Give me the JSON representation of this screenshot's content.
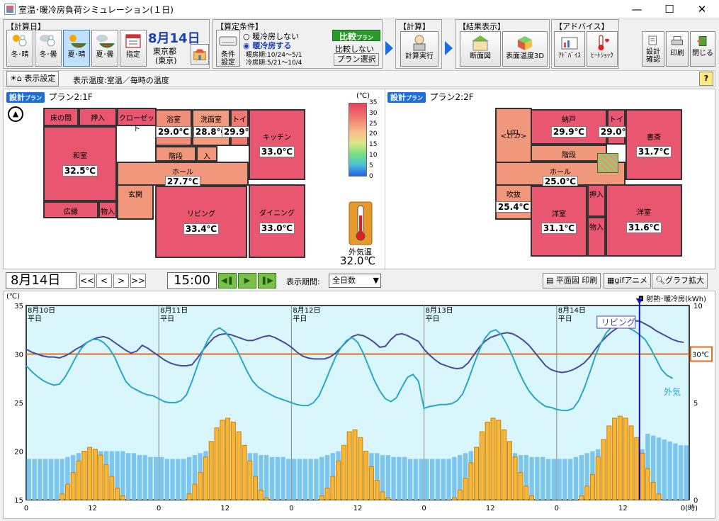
{
  "window": {
    "title": "室温･暖冷房負荷シミュレーション(１日)",
    "minimize": "—",
    "maximize": "☐",
    "close": "✕"
  },
  "calc_day": {
    "label": "【計算日】",
    "buttons": [
      {
        "label": "冬･晴",
        "icon": "sun-snowman-icon"
      },
      {
        "label": "冬･曇",
        "icon": "cloud-snowman-icon"
      },
      {
        "label": "夏･晴",
        "icon": "sun-watermelon-icon",
        "selected": true
      },
      {
        "label": "夏･曇",
        "icon": "cloud-watermelon-icon"
      },
      {
        "label": "指定",
        "icon": "calendar-icon"
      }
    ],
    "date": "8月14日",
    "location1": "東京都",
    "location2": "(東京)"
  },
  "conditions": {
    "label": "【算定条件】",
    "setting_label1": "条件",
    "setting_label2": "設定",
    "radio_off": "暖冷房しない",
    "radio_on": "暖冷房する",
    "heating_period": "暖房期:10/24～5/1",
    "cooling_period": "冷房期:5/21～10/4",
    "compare_label": "比較",
    "compare_sub": "プラン",
    "compare_value": "比較しない",
    "plan_select": "プラン選択"
  },
  "calc": {
    "label": "【計算】",
    "run": "計算実行"
  },
  "result": {
    "label": "【結果表示】",
    "section": "断面図",
    "surface": "表面温度3D"
  },
  "advice": {
    "label": "【アドバイス】",
    "advice": "ｱﾄﾞﾊﾞｲｽ",
    "heatshock": "ﾋｰﾄｼｮｯｸ"
  },
  "right_buttons": {
    "design_check1": "設計",
    "design_check2": "確認",
    "print": "印刷",
    "close": "閉じる"
  },
  "display_bar": {
    "setting": "表示設定",
    "info": "表示温度:室温／毎時の温度",
    "help": "?"
  },
  "floor1": {
    "badge": "設計",
    "badge_sub": "プラン",
    "title": "プラン2:1F",
    "rooms": [
      {
        "name": "床の間",
        "temp": "",
        "color": "#e85670"
      },
      {
        "name": "押入",
        "temp": "",
        "color": "#e85670"
      },
      {
        "name": "クローゼット",
        "temp": "",
        "color": "#e85670"
      },
      {
        "name": "和室",
        "temp": "32.5℃",
        "color": "#e85670"
      },
      {
        "name": "浴室",
        "temp": "29.0℃",
        "color": "#f08e7a"
      },
      {
        "name": "洗面室",
        "temp": "28.8℃",
        "color": "#f09c80"
      },
      {
        "name": "トイレ",
        "temp": "29.9℃",
        "color": "#f07a72"
      },
      {
        "name": "キッチン",
        "temp": "33.0℃",
        "color": "#e85670"
      },
      {
        "name": "階段",
        "temp": "",
        "color": "#f0977c"
      },
      {
        "name": "入",
        "temp": "",
        "color": "#f0977c"
      },
      {
        "name": "ホール",
        "temp": "27.7℃",
        "color": "#f0977c"
      },
      {
        "name": "広縁",
        "temp": "",
        "color": "#e85670"
      },
      {
        "name": "物入",
        "temp": "",
        "color": "#e85670"
      },
      {
        "name": "玄関",
        "temp": "",
        "color": "#f0977c"
      },
      {
        "name": "リビング",
        "temp": "33.4℃",
        "color": "#e85670"
      },
      {
        "name": "ダイニング",
        "temp": "33.0℃",
        "color": "#e85670"
      }
    ]
  },
  "scale": {
    "unit": "(℃)",
    "ticks": [
      "35",
      "30",
      "25",
      "20",
      "15",
      "10",
      "5",
      "0"
    ],
    "outdoor_label": "外気温",
    "outdoor_temp": "32.0℃"
  },
  "floor2": {
    "badge": "設計",
    "badge_sub": "プラン",
    "title": "プラン2:2F",
    "rooms": [
      {
        "name": "<ｴｱｺﾝ>",
        "temp": "",
        "color": "#f0977c"
      },
      {
        "name": "UTL",
        "temp": "",
        "color": "#f0977c"
      },
      {
        "name": "納戸",
        "temp": "29.9℃",
        "color": "#e85670"
      },
      {
        "name": "トイレ",
        "temp": "29.0℃",
        "color": "#e85670"
      },
      {
        "name": "書斎",
        "temp": "31.7℃",
        "color": "#e85670"
      },
      {
        "name": "階段",
        "temp": "",
        "color": "#f0977c"
      },
      {
        "name": "ホール",
        "temp": "25.0℃",
        "color": "#f0977c"
      },
      {
        "name": "吹抜",
        "temp": "25.4℃",
        "color": "#f0977c"
      },
      {
        "name": "押入",
        "temp": "",
        "color": "#e85670"
      },
      {
        "name": "洋室",
        "temp": "31.1℃",
        "color": "#e85670"
      },
      {
        "name": "物入",
        "temp": "",
        "color": "#e85670"
      },
      {
        "name": "洋室",
        "temp": "31.6℃",
        "color": "#e85670"
      }
    ]
  },
  "timebar": {
    "date": "8月14日",
    "nav": [
      "<<",
      "<",
      ">",
      ">>"
    ],
    "time": "15:00",
    "period_label": "表示期間:",
    "period_value": "全日数",
    "print_plan": "平面図 印刷",
    "gif": "gifアニメ",
    "zoom": "グラフ拡大"
  },
  "chart_data": {
    "type": "line",
    "ylabel": "(℃)",
    "y2label": "射熱･暖冷房(kWh)",
    "ylim": [
      15,
      35
    ],
    "y2lim": [
      0,
      10
    ],
    "x_ticks": [
      "0",
      "12",
      "0",
      "12",
      "0",
      "12",
      "0",
      "12",
      "0",
      "12",
      "0(時)"
    ],
    "days": [
      {
        "date": "8月10日",
        "type": "平日"
      },
      {
        "date": "8月11日",
        "type": "平日"
      },
      {
        "date": "8月12日",
        "type": "平日"
      },
      {
        "date": "8月13日",
        "type": "平日"
      },
      {
        "date": "8月14日",
        "type": "平日"
      }
    ],
    "y_ticks": [
      "35",
      "30",
      "25",
      "20",
      "15"
    ],
    "y2_ticks": [
      "10",
      "5",
      "0"
    ],
    "threshold": {
      "value": 30,
      "label": "30℃",
      "color": "#e07020"
    },
    "current_hour": 111,
    "series": [
      {
        "name": "リビング",
        "color": "#4a4a9a",
        "values": [
          30.5,
          30.2,
          30,
          29.8,
          29.7,
          29.7,
          29.6,
          29.8,
          30.1,
          30.5,
          30.8,
          31.2,
          31.5,
          31.7,
          31.8,
          31.6,
          31.2,
          30.8,
          30.4,
          30.1,
          30.3,
          30.9,
          30.6,
          30.2,
          29.8,
          29.4,
          29.1,
          28.9,
          28.8,
          28.8,
          28.9,
          29.6,
          30.4,
          31.1,
          31.7,
          32,
          32.1,
          32,
          31.8,
          31.6,
          31.4,
          31.4,
          31.6,
          31.8,
          31.9,
          31.7,
          31.4,
          31.1,
          30.7,
          30.2,
          29.8,
          29.6,
          29.5,
          29.5,
          29.5,
          29.7,
          30.1,
          30.7,
          31.3,
          31.8,
          32,
          31.9,
          31.6,
          31.2,
          30.7,
          30.8,
          31.5,
          32,
          32.1,
          31.9,
          31.6,
          31.3,
          30.5,
          29.9,
          29.4,
          29,
          28.8,
          28.6,
          28.5,
          28.6,
          29.1,
          29.9,
          30.7,
          31.3,
          31.7,
          31.9,
          32.1,
          32.2,
          32.1,
          31.8,
          31.4,
          30.9,
          30.2,
          29.5,
          28.8,
          28.4,
          28.2,
          28.1,
          28.2,
          28.4,
          28.7,
          29.1,
          29.7,
          30.5,
          31.2,
          31.8,
          32.3,
          32.7,
          33,
          33.2,
          33.4,
          33.4,
          33.1,
          32.8,
          32.4,
          32.1,
          31.8,
          31.5,
          31.3,
          31.2
        ]
      },
      {
        "name": "外気",
        "color": "#2aa6c8",
        "values": [
          28.8,
          28.2,
          27.7,
          27.3,
          27,
          26.8,
          26.9,
          27.6,
          28.6,
          29.7,
          30.6,
          31.2,
          31.5,
          31.5,
          31.2,
          30.6,
          29.7,
          28.4,
          27.2,
          26.6,
          26.3,
          26,
          25.8,
          25.7,
          25.4,
          25.1,
          25,
          25,
          25.2,
          25.8,
          27.2,
          28.8,
          30.4,
          31.6,
          32.4,
          32.7,
          32.3,
          31.6,
          30.6,
          29.4,
          28.2,
          27.2,
          26.6,
          26.2,
          25.9,
          25.6,
          25.4,
          25.2,
          25,
          24.8,
          24.7,
          24.7,
          25,
          25.7,
          27,
          28.4,
          29.7,
          30.7,
          31.4,
          31.7,
          31.2,
          30.1,
          28.7,
          27.3,
          26.2,
          25.4,
          25.1,
          25.5,
          26.6,
          27.6,
          27.9,
          27.2,
          24.4,
          24.6,
          24.7,
          24.8,
          24.8,
          24.9,
          25.2,
          25.9,
          27.3,
          28.9,
          30.4,
          31.6,
          32.3,
          32.5,
          32,
          31,
          29.8,
          28.4,
          27.2,
          26.2,
          25.5,
          25,
          24.6,
          24.5,
          24.3,
          24.2,
          24.2,
          24.4,
          25.2,
          26.5,
          28.1,
          29.8,
          31.2,
          32.2,
          32.8,
          33,
          32.9,
          32.7,
          32.4,
          32,
          31.5,
          30.6,
          29.5,
          28.4,
          27.8,
          27.5
        ]
      },
      {
        "name": "射熱",
        "color": "#f7b638",
        "values": [
          0,
          0,
          0,
          0,
          0,
          0,
          0.3,
          0.8,
          1.4,
          2,
          2.5,
          2.7,
          2.6,
          2.3,
          1.8,
          1.2,
          0.6,
          0.2,
          0,
          0,
          0,
          0,
          0,
          0,
          0,
          0,
          0,
          0,
          0,
          0.3,
          0.8,
          1.4,
          2.2,
          3,
          3.7,
          4.1,
          4.2,
          4,
          3.5,
          2.8,
          2,
          1.2,
          0.5,
          0.1,
          0,
          0,
          0,
          0,
          0,
          0,
          0,
          0,
          0,
          0.2,
          0.6,
          1.2,
          2,
          2.8,
          3.5,
          3.6,
          3.2,
          2.5,
          1.7,
          1,
          0.4,
          0.1,
          0,
          0,
          0,
          0,
          0,
          0,
          0,
          0,
          0,
          0,
          0,
          0.1,
          0.5,
          1.1,
          1.9,
          2.7,
          3.5,
          4,
          4.2,
          4.1,
          3.6,
          3,
          2.2,
          1.4,
          0.7,
          0.2,
          0,
          0,
          0,
          0,
          0,
          0,
          0,
          0,
          0.2,
          0.7,
          1.3,
          2.2,
          3.1,
          3.8,
          4.2,
          4.3,
          4.2,
          3.8,
          3.2,
          2.4,
          1.6,
          0.9,
          0.3,
          0,
          0,
          0,
          0,
          0,
          0,
          0
        ]
      },
      {
        "name": "暖冷房",
        "color": "#7cc6ee",
        "values": [
          2.1,
          2.1,
          2.1,
          2.1,
          2.1,
          2.1,
          2.1,
          2.2,
          2.3,
          2.4,
          2.5,
          2.5,
          2.5,
          2.5,
          2.5,
          2.5,
          2.5,
          2.5,
          2.4,
          2.4,
          2.3,
          2.3,
          2.2,
          2.2,
          2.2,
          2.1,
          2.1,
          2.1,
          2.1,
          2.2,
          2.3,
          2.4,
          2.5,
          2.5,
          2.5,
          2.5,
          2.5,
          2.5,
          2.5,
          2.5,
          2.4,
          2.4,
          2.3,
          2.3,
          2.2,
          2.2,
          2.2,
          2.1,
          2.1,
          2.1,
          2.1,
          2.1,
          2.1,
          2.2,
          2.3,
          2.4,
          2.5,
          2.5,
          2.5,
          2.5,
          2.5,
          2.5,
          2.4,
          2.4,
          2.3,
          2.3,
          2.2,
          2.2,
          2.2,
          2.1,
          2.1,
          2.1,
          2.1,
          2.1,
          2.1,
          2.1,
          2.1,
          2.2,
          2.3,
          2.4,
          2.5,
          2.5,
          2.5,
          2.5,
          2.5,
          2.5,
          2.5,
          2.4,
          2.4,
          2.3,
          2.3,
          2.2,
          2.2,
          2.2,
          2.1,
          2.1,
          2.1,
          2.1,
          2.1,
          2.2,
          2.3,
          2.4,
          2.5,
          2.6,
          2.6,
          2.6,
          2.6,
          2.6,
          2.6,
          2.6,
          2.6,
          2.6,
          3.4,
          3.3,
          3.2,
          3.1,
          3,
          2.9,
          2.8,
          2.8
        ]
      }
    ]
  }
}
